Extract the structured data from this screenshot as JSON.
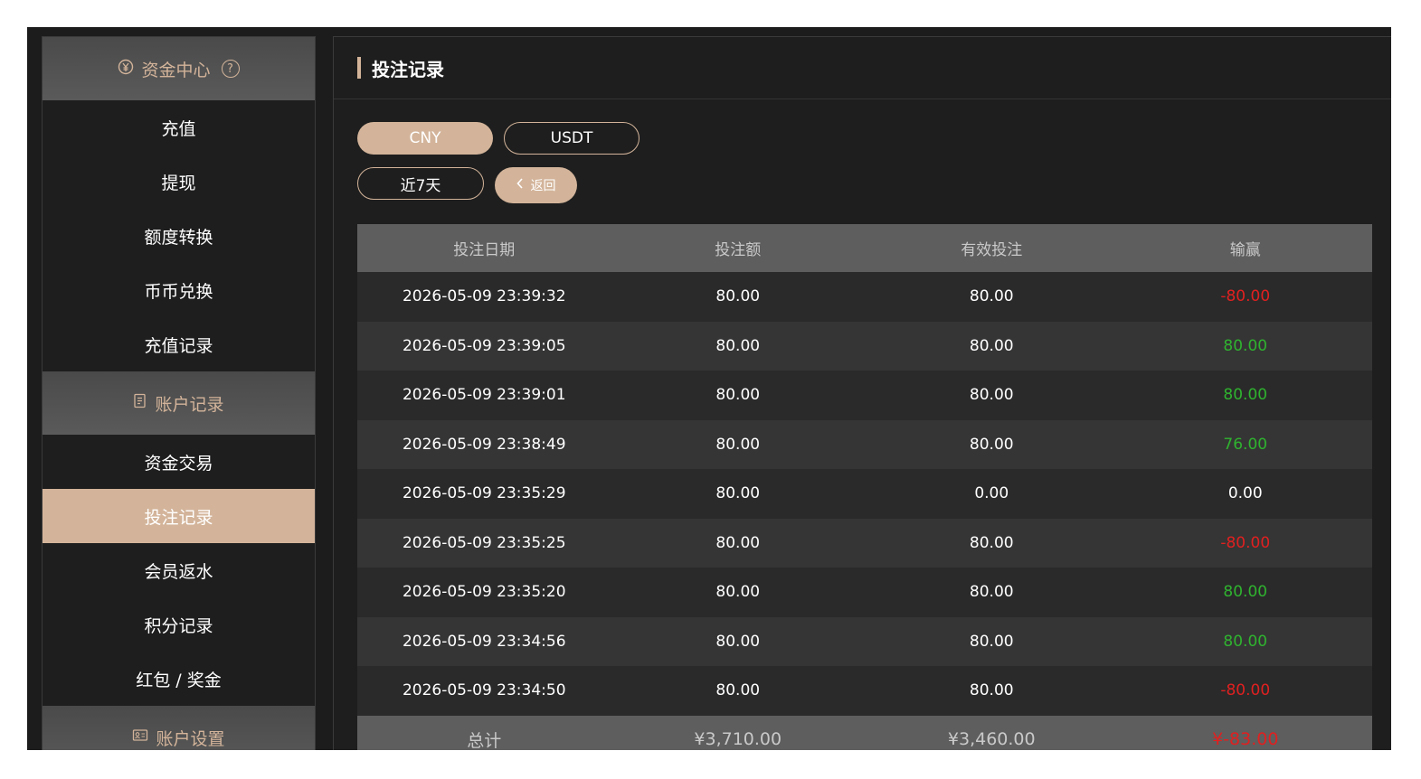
{
  "sidebar": {
    "sections": [
      {
        "title": "资金中心",
        "icon": "yen-circle-icon",
        "help": "?",
        "items": [
          "充值",
          "提现",
          "额度转换",
          "币币兑换",
          "充值记录"
        ]
      },
      {
        "title": "账户记录",
        "icon": "document-icon",
        "items": [
          "资金交易",
          "投注记录",
          "会员返水",
          "积分记录",
          "红包 / 奖金"
        ]
      },
      {
        "title": "账户设置",
        "icon": "user-card-icon",
        "items": []
      }
    ],
    "active_item": "投注记录"
  },
  "main": {
    "title": "投注记录",
    "currency_tabs": [
      "CNY",
      "USDT"
    ],
    "selected_currency": "CNY",
    "period_label": "近7天",
    "back_label": "返回",
    "table": {
      "headers": [
        "投注日期",
        "投注额",
        "有效投注",
        "输赢"
      ],
      "rows": [
        {
          "date": "2026-05-09 23:39:32",
          "bet": "80.00",
          "valid": "80.00",
          "win": "-80.00",
          "result": "loss"
        },
        {
          "date": "2026-05-09 23:39:05",
          "bet": "80.00",
          "valid": "80.00",
          "win": "80.00",
          "result": "win"
        },
        {
          "date": "2026-05-09 23:39:01",
          "bet": "80.00",
          "valid": "80.00",
          "win": "80.00",
          "result": "win"
        },
        {
          "date": "2026-05-09 23:38:49",
          "bet": "80.00",
          "valid": "80.00",
          "win": "76.00",
          "result": "win"
        },
        {
          "date": "2026-05-09 23:35:29",
          "bet": "80.00",
          "valid": "0.00",
          "win": "0.00",
          "result": "draw"
        },
        {
          "date": "2026-05-09 23:35:25",
          "bet": "80.00",
          "valid": "80.00",
          "win": "-80.00",
          "result": "loss"
        },
        {
          "date": "2026-05-09 23:35:20",
          "bet": "80.00",
          "valid": "80.00",
          "win": "80.00",
          "result": "win"
        },
        {
          "date": "2026-05-09 23:34:56",
          "bet": "80.00",
          "valid": "80.00",
          "win": "80.00",
          "result": "win"
        },
        {
          "date": "2026-05-09 23:34:50",
          "bet": "80.00",
          "valid": "80.00",
          "win": "-80.00",
          "result": "loss"
        }
      ],
      "total": {
        "label": "总计",
        "bet": "¥3,710.00",
        "valid": "¥3,460.00",
        "win": "¥-83.00"
      }
    }
  },
  "colors": {
    "accent": "#d3b49a",
    "loss": "#e02020",
    "win": "#2fb32f",
    "background": "#1c1c1c"
  }
}
